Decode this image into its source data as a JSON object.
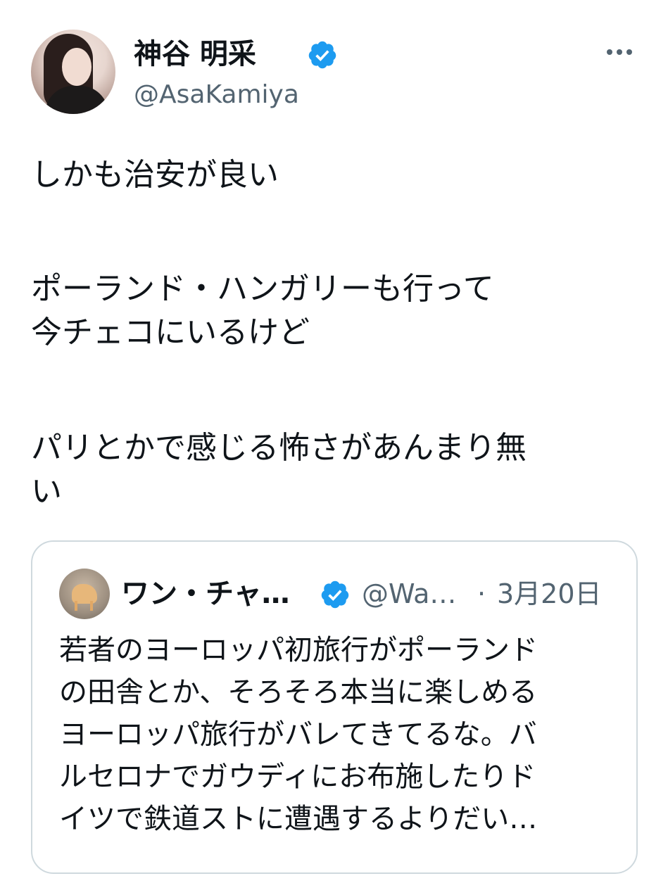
{
  "author": {
    "display_name": "神谷 明采",
    "handle": "@AsaKamiya",
    "verified": true
  },
  "more_icon": "more-horizontal-icon",
  "tweet": {
    "lines": [
      "しかも治安が良い",
      "ポーランド・ハンガリーも行って",
      "今チェコにいるけど",
      "パリとかで感じる怖さがあんまり無",
      "い"
    ]
  },
  "quote": {
    "display_name": "ワン・チャ…",
    "handle": "@Wa…",
    "separator": "·",
    "date": "3月20日",
    "verified": true,
    "lines": [
      "若者のヨーロッパ初旅行がポーランド",
      "の田舎とか、そろそろ本当に楽しめる",
      "ヨーロッパ旅行がバレてきてるな。バ",
      "ルセロナでガウディにお布施したりド",
      "イツで鉄道ストに遭遇するよりだい…"
    ]
  },
  "colors": {
    "text": "#0f1419",
    "secondary": "#536471",
    "verified": "#1d9bf0",
    "border": "#cfd9de"
  }
}
